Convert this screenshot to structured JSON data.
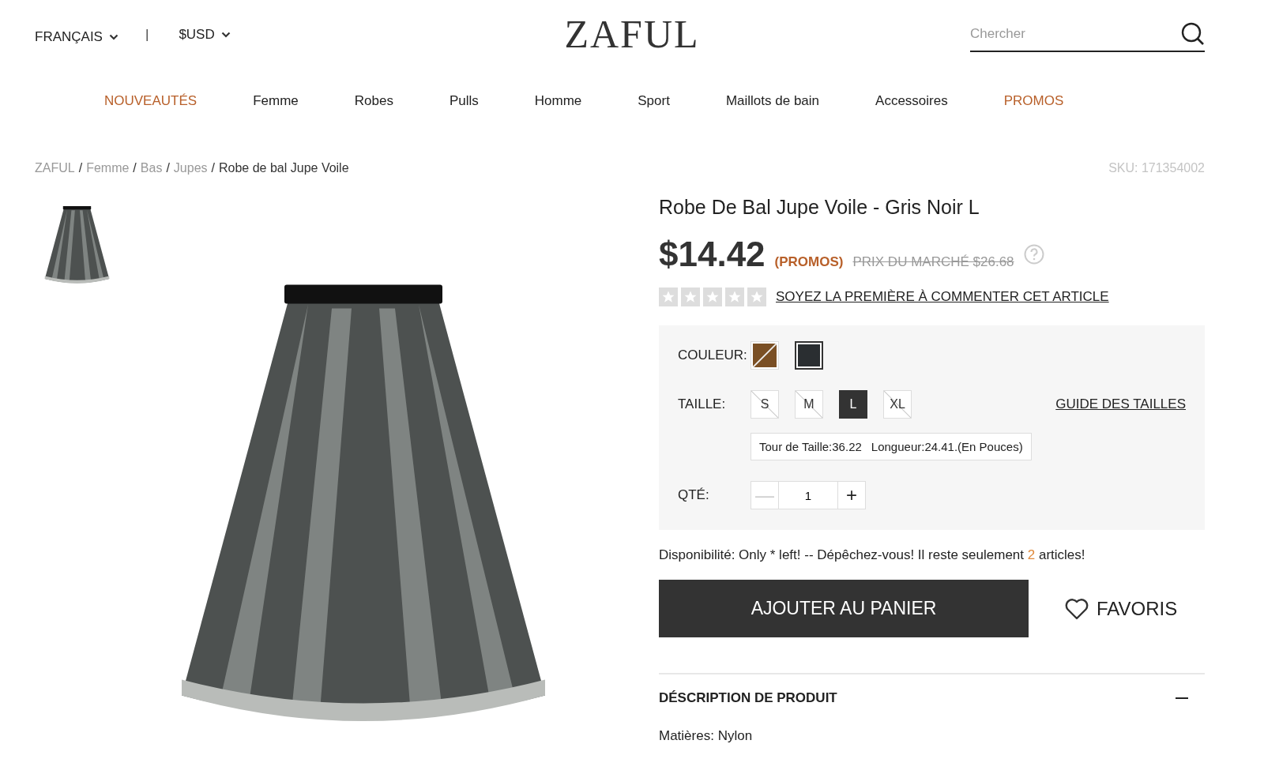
{
  "header": {
    "language": "FRANÇAIS",
    "separator": "|",
    "currency": "$USD",
    "logo": "ZAFUL",
    "search": {
      "placeholder": "Chercher"
    }
  },
  "nav": [
    {
      "label": "NOUVEAUTÉS",
      "highlighted": true
    },
    {
      "label": "Femme",
      "highlighted": false
    },
    {
      "label": "Robes",
      "highlighted": false
    },
    {
      "label": "Pulls",
      "highlighted": false
    },
    {
      "label": "Homme",
      "highlighted": false
    },
    {
      "label": "Sport",
      "highlighted": false
    },
    {
      "label": "Maillots de bain",
      "highlighted": false
    },
    {
      "label": "Accessoires",
      "highlighted": false
    },
    {
      "label": "PROMOS",
      "highlighted": true
    }
  ],
  "breadcrumb": {
    "separator": "/",
    "items": [
      {
        "label": "ZAFUL",
        "current": false
      },
      {
        "label": "Femme",
        "current": false
      },
      {
        "label": "Bas",
        "current": false
      },
      {
        "label": "Jupes",
        "current": false
      },
      {
        "label": "Robe de bal Jupe Voile",
        "current": true
      }
    ]
  },
  "sku": "SKU: 171354002",
  "product": {
    "title": "Robe De Bal Jupe Voile - Gris Noir L",
    "price": "$14.42",
    "promo_tag": "(PROMOS)",
    "market_price": "PRIX DU MARCHÉ $26.68",
    "rating": {
      "stars": 0,
      "link": "SOYEZ LA PREMIÈRE À COMMENTER CET ARTICLE"
    },
    "options": {
      "color_label": "COULEUR:",
      "colors": [
        {
          "color": "#7a4f24",
          "selected": false,
          "available": false
        },
        {
          "color": "#2a2e31",
          "selected": true,
          "available": true
        }
      ],
      "size_label": "TAILLE:",
      "sizes": [
        {
          "label": "S",
          "selected": false,
          "available": false
        },
        {
          "label": "M",
          "selected": false,
          "available": false
        },
        {
          "label": "L",
          "selected": true,
          "available": true
        },
        {
          "label": "XL",
          "selected": false,
          "available": false
        }
      ],
      "size_guide": "GUIDE DES TAILLES",
      "measurements": [
        "Tour de Taille:36.22",
        "Longueur:24.41.(En Pouces)"
      ],
      "qty_label": "QTÉ:",
      "minus": "—",
      "minus_disabled": true,
      "quantity": "1",
      "plus": "+"
    },
    "availability": {
      "before": "Disponibilité: Only * left! -- Dépêchez-vous! Il reste seulement",
      "count": "2",
      "after": "articles!"
    },
    "add_to_cart": "AJOUTER AU PANIER",
    "favorites": "FAVORIS",
    "description": {
      "title": "DÉSCRIPTION DE PRODUIT",
      "expanded": true,
      "lines": [
        "Matières: Nylon"
      ]
    }
  }
}
